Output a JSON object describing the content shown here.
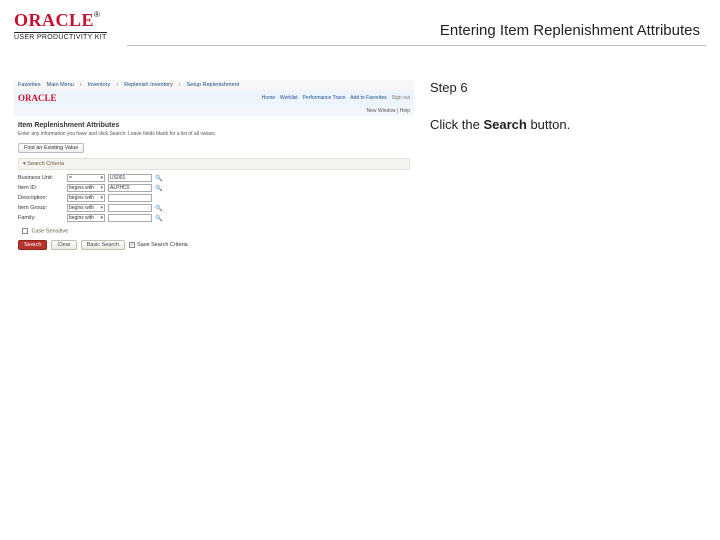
{
  "header": {
    "logo_word": "ORACLE",
    "logo_tm": "®",
    "logo_sub": "USER PRODUCTIVITY KIT",
    "title": "Entering Item Replenishment Attributes"
  },
  "instruction": {
    "step_label": "Step 6",
    "text_prefix": "Click the ",
    "text_bold": "Search",
    "text_suffix": " button."
  },
  "shot": {
    "breadcrumbs": [
      "Favorites",
      "Main Menu",
      "Inventory",
      "Replenish Inventory",
      "Setup Replenishment"
    ],
    "oracle_word": "ORACLE",
    "nav_links": [
      "Home",
      "Worklist",
      "Performance Trace",
      "Add to Favorites",
      "Sign out"
    ],
    "sub_bar": "New Window | Help",
    "page_title": "Item Replenishment Attributes",
    "desc": "Enter any information you have and click Search. Leave fields blank for a list of all values.",
    "find_btn": "Find an Existing Value",
    "section_label": "▾ Search Criteria",
    "form": {
      "rows": [
        {
          "label": "Business Unit:",
          "op": "=",
          "val": "US001",
          "lookup": true
        },
        {
          "label": "Item ID:",
          "op": "begins with",
          "val": "ALPHC0",
          "lookup": true
        },
        {
          "label": "Description:",
          "op": "begins with",
          "val": "",
          "lookup": false
        },
        {
          "label": "Item Group:",
          "op": "begins with",
          "val": "",
          "lookup": true
        },
        {
          "label": "Family:",
          "op": "begins with",
          "val": "",
          "lookup": true
        }
      ]
    },
    "case_label": "Case Sensitive",
    "buttons": {
      "search": "Search",
      "clear": "Clear",
      "basic": "Basic Search",
      "save": "Save Search Criteria"
    }
  }
}
